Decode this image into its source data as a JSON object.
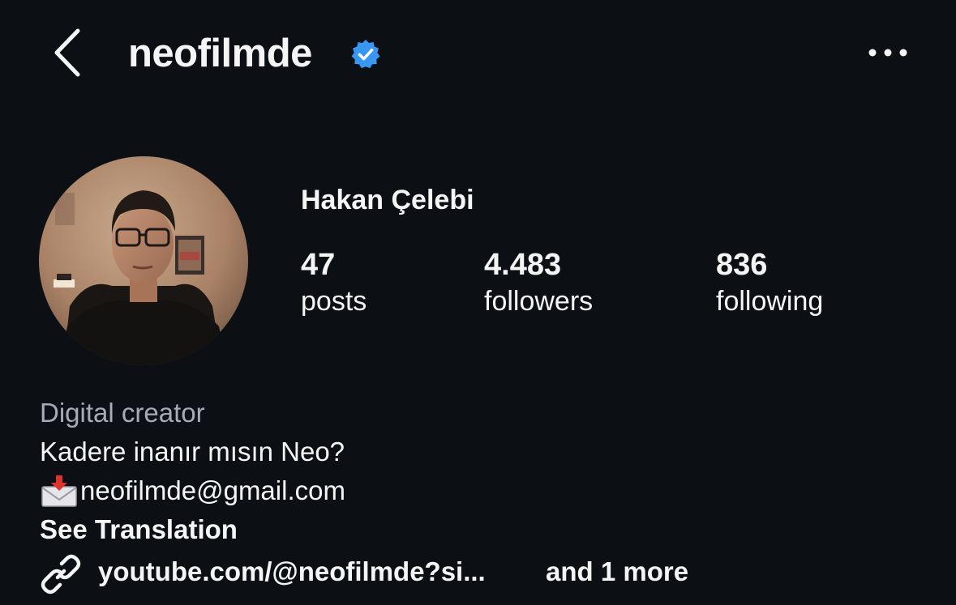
{
  "header": {
    "username": "neofilmde",
    "verified_icon": "verified-badge-icon",
    "back_icon": "chevron-left-icon",
    "more_icon": "more-horizontal-icon",
    "accent_color": "#3897f0"
  },
  "profile": {
    "display_name": "Hakan Çelebi",
    "avatar": "avatar-photo",
    "stats": {
      "posts": {
        "value": "47",
        "label": "posts"
      },
      "followers": {
        "value": "4.483",
        "label": "followers"
      },
      "following": {
        "value": "836",
        "label": "following"
      }
    }
  },
  "bio": {
    "category": "Digital creator",
    "line1": "Kadere inanır mısın Neo?",
    "email": "neofilmde@gmail.com",
    "email_icon": "envelope-arrow-icon",
    "see_translation": "See Translation",
    "link_text": "youtube.com/@neofilmde?si...",
    "link_more": "and 1 more",
    "link_icon": "link-icon"
  }
}
